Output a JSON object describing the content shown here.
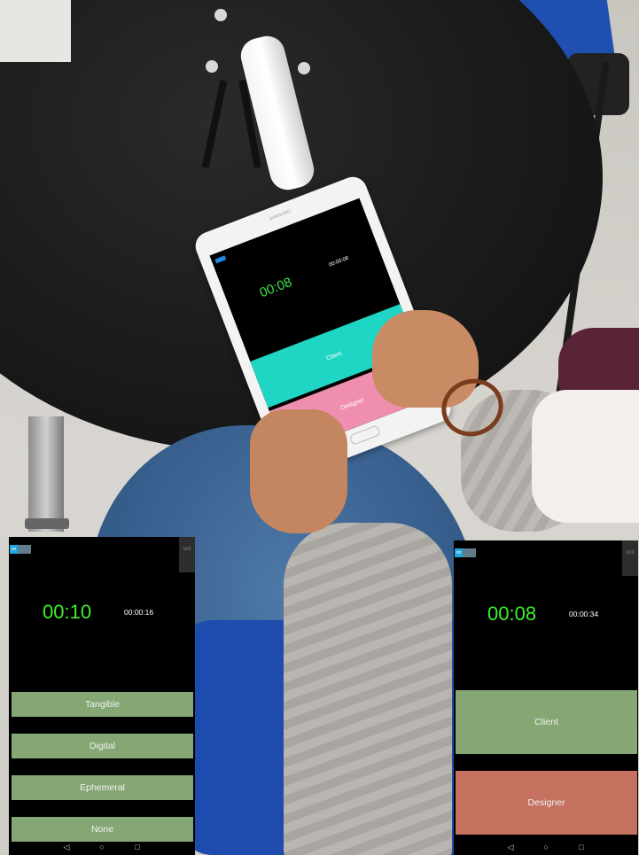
{
  "tablet_photo": {
    "brand": "SAMSUNG",
    "toggle": "on",
    "big_timer": "00:08",
    "small_timer": "00:00:08",
    "client_label": "Client",
    "designer_label": "Designer"
  },
  "left_screen": {
    "toggle": "on",
    "exit_label": "exit",
    "big_timer": "00:10",
    "small_timer": "00:00:16",
    "options": [
      {
        "label": "Tangible"
      },
      {
        "label": "Digital"
      },
      {
        "label": "Ephemeral"
      },
      {
        "label": "None"
      }
    ],
    "nav": {
      "back": "◁",
      "home": "○",
      "recents": "□"
    }
  },
  "right_screen": {
    "toggle": "on",
    "exit_label": "exit",
    "big_timer": "00:08",
    "small_timer": "00:00:34",
    "client_label": "Client",
    "designer_label": "Designer",
    "nav": {
      "back": "◁",
      "home": "○",
      "recents": "□"
    }
  },
  "colors": {
    "timer_green": "#3ef02e",
    "option_green": "#84a774",
    "client_green": "#84a774",
    "designer_red": "#c4715f",
    "client_teal": "#1fd5c3",
    "designer_pink": "#f08eaf",
    "toggle_blue": "#1ea7e0"
  }
}
